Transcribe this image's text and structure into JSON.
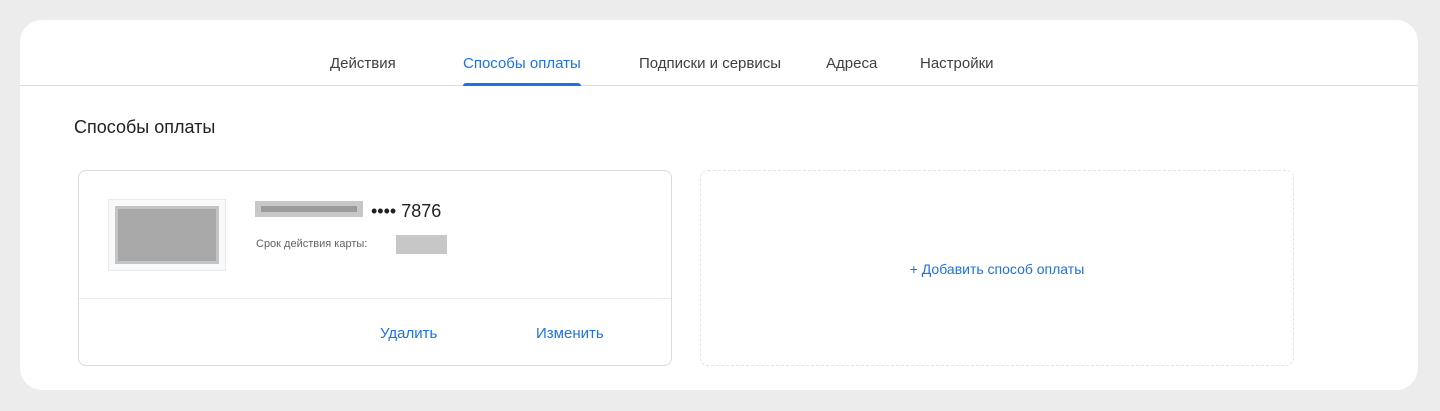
{
  "tabs": [
    {
      "label": "Действия",
      "active": false
    },
    {
      "label": "Способы оплаты",
      "active": true
    },
    {
      "label": "Подписки и сервисы",
      "active": false
    },
    {
      "label": "Адреса",
      "active": false
    },
    {
      "label": "Настройки",
      "active": false
    }
  ],
  "section": {
    "title": "Способы оплаты"
  },
  "payment_card": {
    "number_masked": "•••• 7876",
    "expiry_label": "Срок действия карты:",
    "delete_label": "Удалить",
    "edit_label": "Изменить"
  },
  "add_payment": {
    "label": "+ Добавить способ оплаты"
  },
  "colors": {
    "accent": "#1a73e8",
    "text": "#202124",
    "border": "#dadce0",
    "frame": "#ececec"
  }
}
